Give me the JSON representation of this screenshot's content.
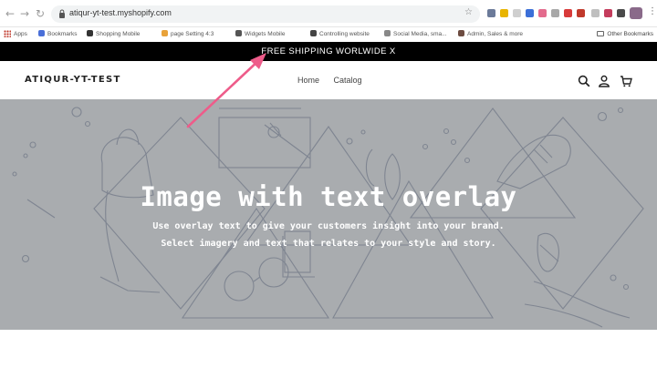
{
  "browser": {
    "url": "atiqur-yt-test.myshopify.com",
    "bookmarks": [
      "Apps",
      "Bookmarks",
      "Shopping Mobile",
      "page Setting 4:3",
      "Widgets Mobile",
      "Controlling website",
      "Social Media, sma...",
      "Admin, Sales & more"
    ],
    "other_bookmarks": "Other Bookmarks"
  },
  "announcement": "FREE SHIPPING WORLWIDE X",
  "header": {
    "logo": "ATIQUR-YT-TEST",
    "nav": [
      "Home",
      "Catalog"
    ]
  },
  "hero": {
    "title": "Image with text overlay",
    "subtitle_1": "Use overlay text to give your customers insight into your brand.",
    "subtitle_2": "Select imagery and text that relates to your style and story."
  },
  "colors": {
    "announcement_bg": "#000000",
    "hero_bg": "#a9acaf",
    "arrow": "#ee5c8a"
  }
}
